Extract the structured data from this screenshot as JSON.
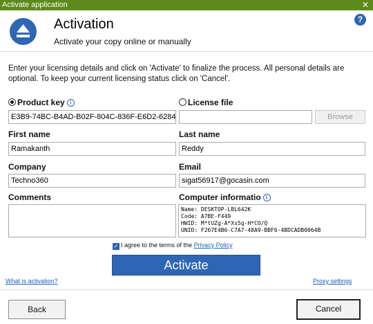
{
  "window": {
    "title": "Activate application",
    "close_glyph": "✕"
  },
  "header": {
    "title": "Activation",
    "subtitle": "Activate your copy online or manually",
    "help_glyph": "?"
  },
  "intro": "Enter your licensing details and click on 'Activate' to finalize the process. All personal details are optional. To keep your current licensing status click on 'Cancel'.",
  "product_key": {
    "label": "Product key",
    "value": "E3B9-74BC-B4AD-B02F-804C-836F-E6D2-6284",
    "selected": true
  },
  "license_file": {
    "label": "License file",
    "value": "",
    "browse_label": "Browse",
    "selected": false
  },
  "first_name": {
    "label": "First name",
    "value": "Ramakanth"
  },
  "last_name": {
    "label": "Last name",
    "value": "Reddy"
  },
  "company": {
    "label": "Company",
    "value": "Techno360"
  },
  "email": {
    "label": "Email",
    "value": "sigat56917@gocasin.com"
  },
  "comments": {
    "label": "Comments",
    "value": ""
  },
  "computer_info": {
    "label": "Computer informatio",
    "lines": [
      "Name: DESKTOP-LBL642K",
      "Code: A7BE-F449",
      "HWID: M*tUZg-A*Xs5g-H*CO/Q",
      "UNID: F267E4B6-C7A7-48A9-BBF6-4BDCADB0064B"
    ]
  },
  "agree": {
    "text": "I agree to the terms of the ",
    "link": "Privacy Policy",
    "checked": true
  },
  "activate_label": "Activate",
  "links": {
    "what_is": "What is activation?",
    "proxy": "Proxy settings"
  },
  "buttons": {
    "back": "Back",
    "cancel": "Cancel"
  },
  "colors": {
    "titlebar": "#5c8a1c",
    "accent": "#2e66b3"
  }
}
